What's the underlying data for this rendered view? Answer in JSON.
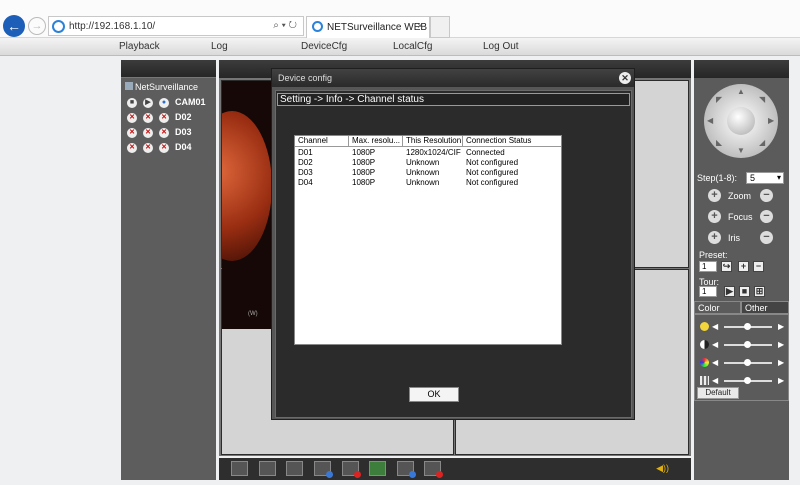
{
  "browser": {
    "url": "http://192.168.1.10/",
    "url_controls": "⌕ ▾ ↻",
    "tab_title": "NETSurveillance WEB",
    "tab_close": "×"
  },
  "menu": {
    "playback": "Playback",
    "log": "Log",
    "devicecfg": "DeviceCfg",
    "localcfg": "LocalCfg",
    "logout": "Log Out"
  },
  "devices": {
    "name": "NetSurveillance",
    "channels": [
      {
        "label": "CAM01",
        "connected": true
      },
      {
        "label": "D02",
        "connected": false
      },
      {
        "label": "D03",
        "connected": false
      },
      {
        "label": "D04",
        "connected": false
      }
    ]
  },
  "video": {
    "timestamp": "(W)"
  },
  "ptz": {
    "step_label": "Step(1-8):",
    "step_value": "5",
    "zoom": "Zoom",
    "focus": "Focus",
    "iris": "Iris",
    "preset_label": "Preset:",
    "preset_value": "1",
    "tour_label": "Tour:",
    "tour_value": "1",
    "tab_color": "Color",
    "tab_other": "Other",
    "default_button": "Default"
  },
  "dialog": {
    "title": "Device config",
    "breadcrumb": "Setting -> Info -> Channel status",
    "columns": [
      "Channel",
      "Max. resolu...",
      "This Resolution",
      "Connection Status"
    ],
    "rows": [
      [
        "D01",
        "1080P",
        "1280x1024/CIF",
        "Connected"
      ],
      [
        "D02",
        "1080P",
        "Unknown",
        "Not configured"
      ],
      [
        "D03",
        "1080P",
        "Unknown",
        "Not configured"
      ],
      [
        "D04",
        "1080P",
        "Unknown",
        "Not configured"
      ]
    ],
    "ok_button": "OK"
  }
}
